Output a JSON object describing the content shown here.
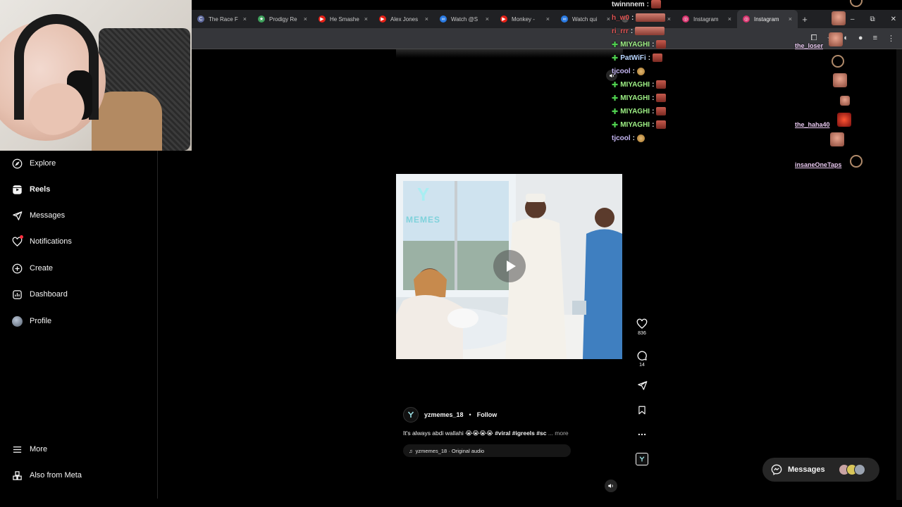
{
  "browser": {
    "tabs": [
      {
        "label": "The Race F",
        "fav": "C",
        "fav_color": "#5f6a9e",
        "active": false
      },
      {
        "label": "Prodigy Re",
        "fav": "★",
        "fav_color": "#3da05a",
        "active": false
      },
      {
        "label": "He Smashe",
        "fav": "▶",
        "fav_color": "#e62117",
        "active": false
      },
      {
        "label": "Alex Jones",
        "fav": "▶",
        "fav_color": "#e62117",
        "active": false
      },
      {
        "label": "Watch @S",
        "fav": "∞",
        "fav_color": "#2a7ae2",
        "active": false
      },
      {
        "label": "Monkey -",
        "fav": "▶",
        "fav_color": "#e62117",
        "active": false
      },
      {
        "label": "Watch qui",
        "fav": "∞",
        "fav_color": "#2a7ae2",
        "active": false
      },
      {
        "label": "",
        "fav": "",
        "fav_color": "#555555",
        "active": false
      },
      {
        "label": "Instagram",
        "fav": "◎",
        "fav_color": "#d6306b",
        "active": false
      },
      {
        "label": "Instagram",
        "fav": "◎",
        "fav_color": "#d6306b",
        "active": true
      }
    ],
    "close_glyph": "×",
    "newtab_glyph": "+",
    "window_controls": [
      "–",
      "⧉",
      "✕"
    ]
  },
  "sidebar": {
    "items": [
      {
        "label": "Explore",
        "icon": "compass-icon",
        "bold": false
      },
      {
        "label": "Reels",
        "icon": "reels-icon",
        "bold": true
      },
      {
        "label": "Messages",
        "icon": "send-icon",
        "bold": false
      },
      {
        "label": "Notifications",
        "icon": "heart-icon",
        "bold": false
      },
      {
        "label": "Create",
        "icon": "plus-square-icon",
        "bold": false
      },
      {
        "label": "Dashboard",
        "icon": "dashboard-icon",
        "bold": false
      },
      {
        "label": "Profile",
        "icon": "avatar-icon",
        "bold": false
      }
    ],
    "bottom_items": [
      {
        "label": "More",
        "icon": "hamburger-icon"
      },
      {
        "label": "Also from Meta",
        "icon": "meta-grid-icon"
      }
    ]
  },
  "reel": {
    "watermark_letter": "Y",
    "watermark_text": "MEMES",
    "username": "yzmemes_18",
    "separator": "•",
    "follow_label": "Follow",
    "caption_text": "It's always abdi wallahi 😭😭😭😭",
    "caption_tags": "#viral #igreels #sc",
    "caption_more": "... more",
    "audio_label": "yzmemes_18 · Original audio",
    "likes": "836",
    "comments": "14"
  },
  "chat": {
    "rows": [
      {
        "name": "twinnnem",
        "color": "c-white",
        "plus": false,
        "emote": "red"
      },
      {
        "name": "h_w0",
        "color": "c-red",
        "plus": false,
        "emote": "wide"
      },
      {
        "name": "ri_rrr",
        "color": "c-red",
        "plus": false,
        "emote": "wide"
      },
      {
        "name": "MIYAGHI",
        "color": "c-green",
        "plus": true,
        "emote": "red"
      },
      {
        "name": "PatWiFi",
        "color": "c-blue",
        "plus": true,
        "emote": "red"
      },
      {
        "name": "tjcool",
        "color": "c-violet",
        "plus": false,
        "emote": "cookie"
      },
      {
        "name": "MIYAGHI",
        "color": "c-green",
        "plus": true,
        "emote": "red"
      },
      {
        "name": "MIYAGHI",
        "color": "c-green",
        "plus": true,
        "emote": "red"
      },
      {
        "name": "MIYAGHI",
        "color": "c-green",
        "plus": true,
        "emote": "red"
      },
      {
        "name": "MIYAGHI",
        "color": "c-green",
        "plus": true,
        "emote": "red"
      },
      {
        "name": "tjcool",
        "color": "c-violet",
        "plus": false,
        "emote": "cookie"
      }
    ],
    "separator": ":"
  },
  "side_chat": {
    "names": [
      "the_loser",
      "the_haha40",
      "insaneOneTaps"
    ]
  },
  "messages_pill": {
    "label": "Messages"
  }
}
